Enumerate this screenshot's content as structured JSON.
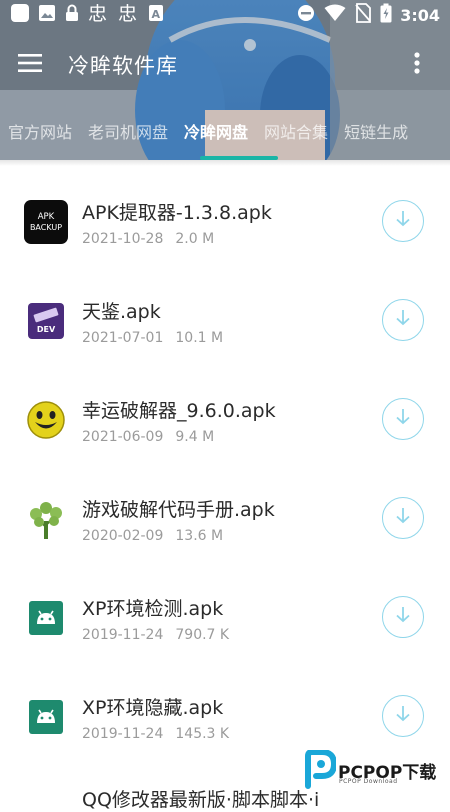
{
  "status_bar": {
    "time": "3:04",
    "left_icons": [
      "square-icon",
      "image-icon",
      "lock-icon",
      "app-icon-1",
      "app-icon-2",
      "font-icon"
    ],
    "right_icons": [
      "do-not-disturb-icon",
      "wifi-icon",
      "no-sim-icon",
      "battery-icon"
    ]
  },
  "toolbar": {
    "title": "冷眸软件库",
    "menu_icon": "hamburger-menu-icon",
    "more_icon": "more-vertical-icon"
  },
  "tabs": [
    {
      "label": "官方网站",
      "active": false
    },
    {
      "label": "老司机网盘",
      "active": false
    },
    {
      "label": "冷眸网盘",
      "active": true
    },
    {
      "label": "网站合集",
      "active": false
    },
    {
      "label": "短链生成",
      "active": false
    }
  ],
  "accent_color": "#19b5a6",
  "download_button_color": "#8fd6ea",
  "files": [
    {
      "name": "APK提取器-1.3.8.apk",
      "date": "2021-10-28",
      "size": "2.0 M",
      "icon": "apk-backup-icon",
      "icon_text_1": "APK",
      "icon_text_2": "BACKUP"
    },
    {
      "name": "天鉴.apk",
      "date": "2021-07-01",
      "size": "10.1 M",
      "icon": "dev-app-icon",
      "icon_text_1": "DEV"
    },
    {
      "name": "幸运破解器_9.6.0.apk",
      "date": "2021-06-09",
      "size": "9.4 M",
      "icon": "smiley-icon"
    },
    {
      "name": "游戏破解代码手册.apk",
      "date": "2020-02-09",
      "size": "13.6 M",
      "icon": "tree-icon"
    },
    {
      "name": "XP环境检测.apk",
      "date": "2019-11-24",
      "size": "790.7 K",
      "icon": "android-icon"
    },
    {
      "name": "XP环境隐藏.apk",
      "date": "2019-11-24",
      "size": "145.3 K",
      "icon": "android-icon"
    }
  ],
  "partial_item": {
    "name": "QQ修改器最新版·脚本脚本·i"
  },
  "watermark": {
    "brand": "PCPOP下载",
    "sub": "PCPOP Download",
    "icon": "pcpop-logo-icon"
  }
}
